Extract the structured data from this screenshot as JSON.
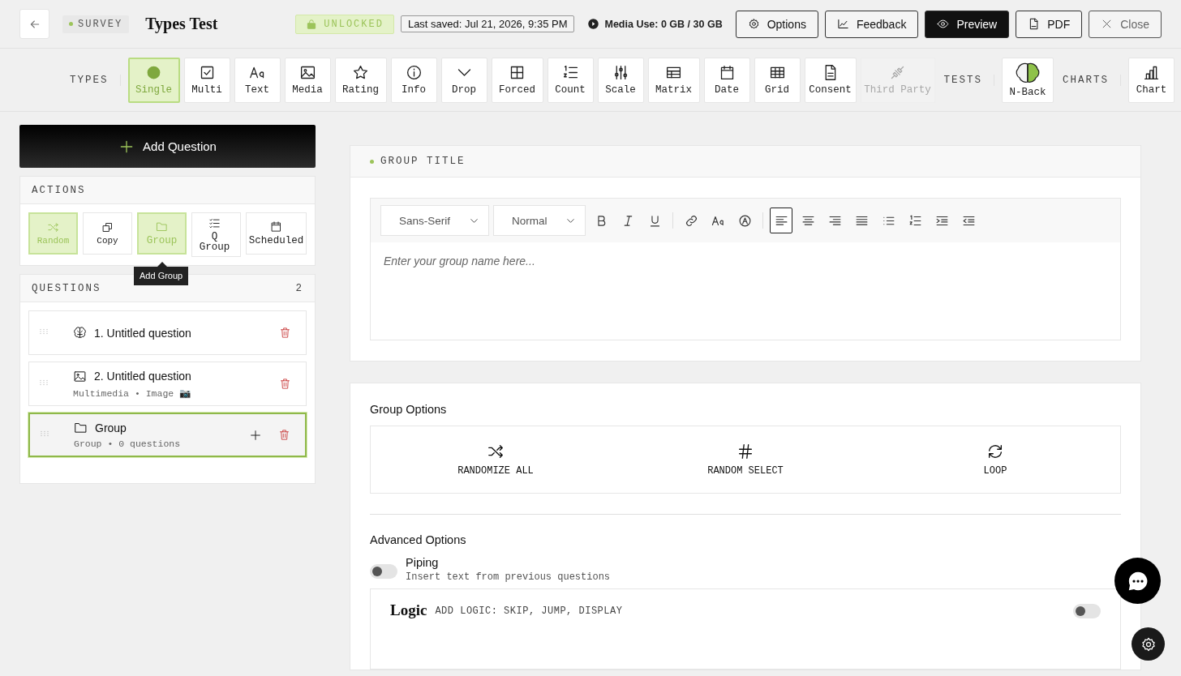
{
  "header": {
    "badge": "SURVEY",
    "title": "Types Test",
    "lock": {
      "label": "UNLOCKED",
      "locked": false
    },
    "saved": "Last saved: Jul 21, 2026, 9:35 PM",
    "media": "Media Use: 0 GB / 30 GB",
    "buttons": [
      {
        "label": "Options",
        "kind": "gear",
        "primary": false,
        "muted": false
      },
      {
        "label": "Feedback",
        "kind": "chart-line",
        "primary": false,
        "muted": false
      },
      {
        "label": "Preview",
        "kind": "eye",
        "primary": true,
        "muted": false
      },
      {
        "label": "PDF",
        "kind": "pdf",
        "primary": false,
        "muted": false
      },
      {
        "label": "Close",
        "kind": "close",
        "primary": false,
        "muted": true
      }
    ]
  },
  "toolbar": [
    {
      "label": "TYPES",
      "items": [
        {
          "label": "Single",
          "kind": "dot",
          "selected": true,
          "disabled": false
        },
        {
          "label": "Multi",
          "kind": "checkbox",
          "selected": false,
          "disabled": false
        },
        {
          "label": "Text",
          "kind": "text",
          "selected": false,
          "disabled": false
        },
        {
          "label": "Media",
          "kind": "image",
          "selected": false,
          "disabled": false
        },
        {
          "label": "Rating",
          "kind": "star",
          "selected": false,
          "disabled": false
        },
        {
          "label": "Info",
          "kind": "info",
          "selected": false,
          "disabled": false
        },
        {
          "label": "Drop",
          "kind": "chevron",
          "selected": false,
          "disabled": false
        },
        {
          "label": "Forced",
          "kind": "grid4",
          "selected": false,
          "disabled": false
        },
        {
          "label": "Count",
          "kind": "numlist",
          "selected": false,
          "disabled": false
        },
        {
          "label": "Scale",
          "kind": "sliders",
          "selected": false,
          "disabled": false
        },
        {
          "label": "Matrix",
          "kind": "table",
          "selected": false,
          "disabled": false
        },
        {
          "label": "Date",
          "kind": "calendar",
          "selected": false,
          "disabled": false
        },
        {
          "label": "Grid",
          "kind": "grid9",
          "selected": false,
          "disabled": false
        },
        {
          "label": "Consent",
          "kind": "doc",
          "selected": false,
          "disabled": false
        },
        {
          "label": "Third Party",
          "kind": "plug",
          "selected": false,
          "disabled": true
        }
      ]
    },
    {
      "label": "TESTS",
      "items": [
        {
          "label": "N-Back",
          "kind": "brain",
          "selected": false,
          "disabled": false
        }
      ]
    },
    {
      "label": "CHARTS",
      "items": [
        {
          "label": "Chart",
          "kind": "bars",
          "selected": false,
          "disabled": false
        }
      ]
    }
  ],
  "add_question": "Add Question",
  "actions": {
    "title": "ACTIONS",
    "tooltip": "Add Group",
    "items": [
      {
        "label": "Random",
        "kind": "shuffle",
        "selected": true
      },
      {
        "label": "Copy",
        "kind": "copy",
        "selected": false
      },
      {
        "label": "Group",
        "kind": "folder",
        "selected": true
      },
      {
        "label": "Q Group",
        "kind": "checklist",
        "selected": false
      },
      {
        "label": "Scheduled",
        "kind": "calendar-blank",
        "selected": false
      }
    ]
  },
  "questions": {
    "title": "QUESTIONS",
    "count": "2",
    "items": [
      {
        "title": "1. Untitled question",
        "kind": "brain-outline",
        "selected": false
      },
      {
        "title": "2. Untitled question",
        "subtitle": "Multimedia • Image 📷",
        "kind": "image",
        "selected": false
      },
      {
        "title": "Group",
        "subtitle": "Group • 0 questions",
        "kind": "folder",
        "selected": true
      }
    ]
  },
  "group_title": {
    "label": "GROUP TITLE",
    "font": "Sans-Serif",
    "size": "Normal",
    "placeholder": "Enter your group name here...",
    "tools": [
      {
        "kind": "bold",
        "selected": false
      },
      {
        "kind": "italic",
        "selected": false
      },
      {
        "kind": "underline",
        "selected": false
      },
      {
        "kind": "link",
        "selected": false
      },
      {
        "kind": "textsize",
        "selected": false
      },
      {
        "kind": "clear",
        "selected": false
      },
      {
        "kind": "align-left",
        "selected": true
      },
      {
        "kind": "align-center",
        "selected": false
      },
      {
        "kind": "align-right",
        "selected": false
      },
      {
        "kind": "justify",
        "selected": false
      },
      {
        "kind": "bullets",
        "selected": false
      },
      {
        "kind": "numlist",
        "selected": false
      },
      {
        "kind": "indent",
        "selected": false
      },
      {
        "kind": "outdent",
        "selected": false
      }
    ]
  },
  "group_options": {
    "title": "Group Options",
    "options": [
      {
        "label": "RANDOMIZE ALL",
        "kind": "shuffle"
      },
      {
        "label": "RANDOM SELECT",
        "kind": "hash"
      },
      {
        "label": "LOOP",
        "kind": "loop"
      }
    ]
  },
  "advanced": {
    "title": "Advanced Options",
    "piping": {
      "label": "Piping",
      "description": "Insert text from previous questions",
      "on": false
    },
    "logic": {
      "title": "Logic",
      "description": "ADD LOGIC: SKIP, JUMP, DISPLAY",
      "on": false
    }
  }
}
